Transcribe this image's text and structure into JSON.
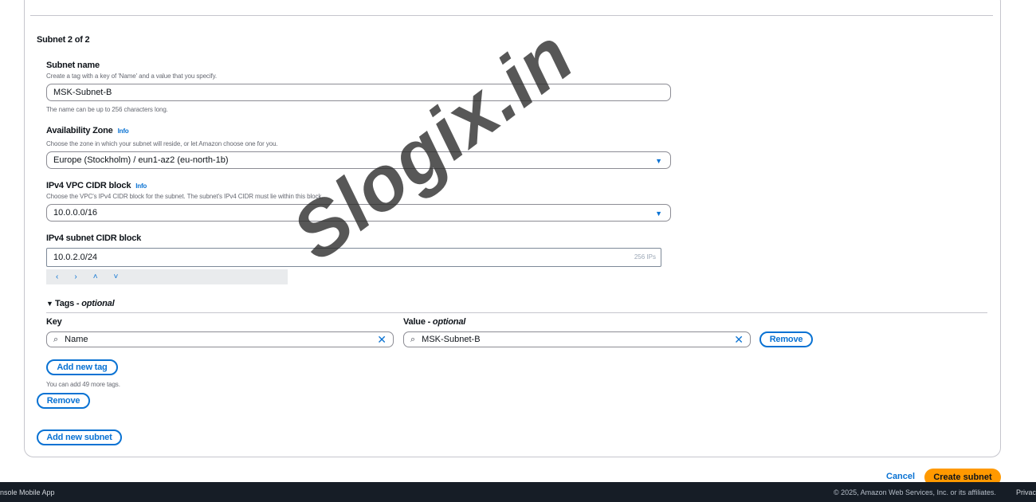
{
  "section": {
    "title": "Subnet 2 of 2"
  },
  "subnet_name": {
    "label": "Subnet name",
    "description": "Create a tag with a key of 'Name' and a value that you specify.",
    "value": "MSK-Subnet-B",
    "hint": "The name can be up to 256 characters long."
  },
  "availability_zone": {
    "label": "Availability Zone",
    "info": "Info",
    "description": "Choose the zone in which your subnet will reside, or let Amazon choose one for you.",
    "value": "Europe (Stockholm) / eun1-az2 (eu-north-1b)"
  },
  "vpc_cidr": {
    "label": "IPv4 VPC CIDR block",
    "info": "Info",
    "description": "Choose the VPC's IPv4 CIDR block for the subnet. The subnet's IPv4 CIDR must lie within this block.",
    "value": "10.0.0.0/16"
  },
  "subnet_cidr": {
    "label": "IPv4 subnet CIDR block",
    "value": "10.0.2.0/24",
    "ips": "256 IPs",
    "stepper": [
      "‹",
      "›",
      "˄",
      "˅"
    ]
  },
  "tags": {
    "title": "Tags -",
    "title_optional": "optional",
    "key_label": "Key",
    "value_label": "Value -",
    "value_optional": "optional",
    "key_value": "Name",
    "value_value": "MSK-Subnet-B",
    "remove_label": "Remove",
    "add_tag_label": "Add new tag",
    "remaining": "You can add 49 more tags."
  },
  "subnet_remove_label": "Remove",
  "add_subnet_label": "Add new subnet",
  "actions": {
    "cancel": "Cancel",
    "create": "Create subnet"
  },
  "footer": {
    "left": "nsole Mobile App",
    "copyright": "© 2025, Amazon Web Services, Inc. or its affiliates.",
    "privacy": "Privac"
  },
  "watermark": "Slogix.in",
  "icons": {
    "search": "search-icon",
    "clear": "close-icon",
    "dropdown": "caret-down-icon",
    "expand": "triangle-down-icon"
  },
  "colors": {
    "accent": "#0972d3",
    "primary": "#ff9900",
    "footer_bg": "#161d26"
  }
}
